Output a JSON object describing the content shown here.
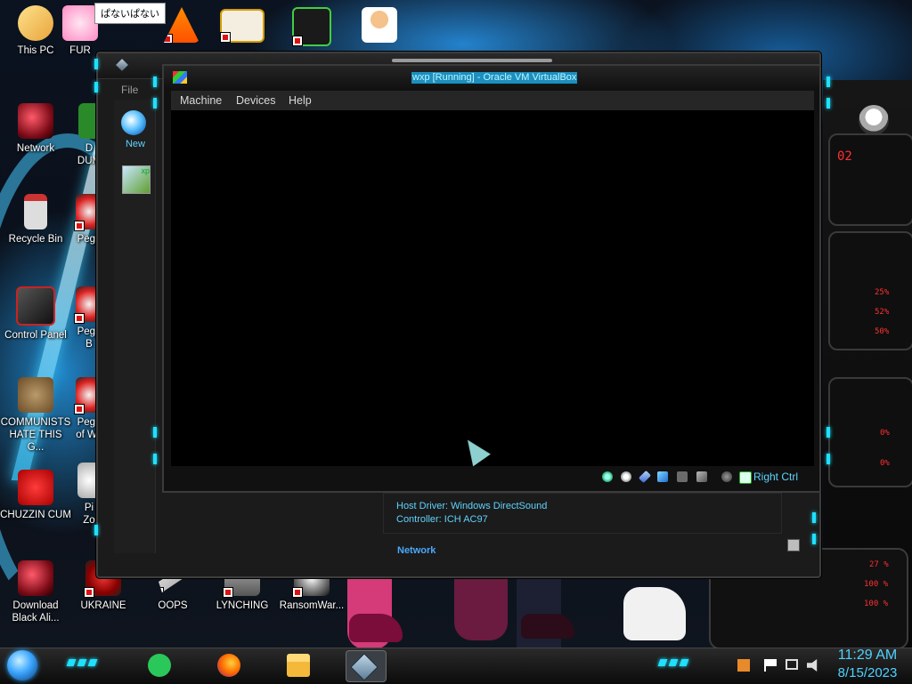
{
  "desktop": {
    "tooltip": "ぱないぱない",
    "icons": {
      "this_pc": "This PC",
      "fur": "FUR",
      "network": "Network",
      "d_dum": "D\nDUM",
      "recycle_bin": "Recycle Bin",
      "pegg1": "Pegg",
      "control_panel": "Control Panel",
      "pegg2": "Pegg\nB",
      "communists": "COMMUNISTS HATE THIS G...",
      "pegg_of_wa": "Pegg\nof Wa",
      "chuzzin": "CHUZZIN CUM",
      "pi_zo": "Pi\nZo",
      "download_black": "Download Black Ali...",
      "ukraine": "UKRAINE",
      "oops": "OOPS",
      "lynching": "LYNCHING",
      "ransomware": "RansomWar..."
    }
  },
  "manager_window": {
    "menu_file": "File",
    "new_label": "New",
    "vm_icon_text": "xp",
    "details": {
      "host_driver": "Host Driver:  Windows DirectSound",
      "controller": "Controller:    ICH AC97",
      "network_heading": "Network"
    }
  },
  "vm_window": {
    "title": "wxp [Running] - Oracle VM VirtualBox",
    "menu": [
      "Machine",
      "Devices",
      "Help"
    ],
    "host_key": "Right Ctrl"
  },
  "right_panel": {
    "texts": [
      "02",
      "25%",
      "52%",
      "50%",
      "0%",
      "0%",
      "27 %",
      "100 %",
      "100 %"
    ]
  },
  "taskbar": {
    "clock_time": "11:29 AM",
    "clock_date": "8/15/2023"
  },
  "colors": {
    "accent_cyan": "#1fe0ff",
    "status_text": "#5fd4ff",
    "title_highlight": "#1c8fbf"
  }
}
